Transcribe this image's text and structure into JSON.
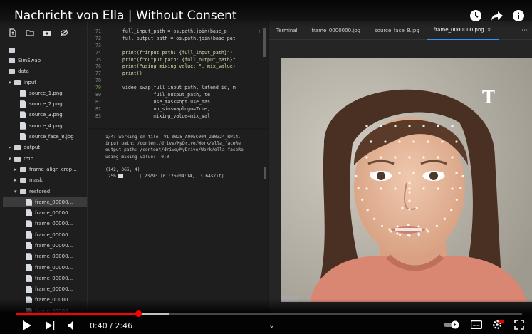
{
  "video": {
    "title": "Nachricht von Ella | Without Consent",
    "current_time": "0:40",
    "duration": "2:46",
    "time_separator": " / ",
    "progress_fraction": 0.241
  },
  "explorer": {
    "items": [
      {
        "label": "..",
        "type": "folder",
        "indent": 0,
        "caret": ""
      },
      {
        "label": "SimSwap",
        "type": "folder",
        "indent": 0,
        "caret": ""
      },
      {
        "label": "data",
        "type": "folder",
        "indent": 0,
        "caret": ""
      },
      {
        "label": "input",
        "type": "folder",
        "indent": 1,
        "caret": "▾"
      },
      {
        "label": "source_1.png",
        "type": "file",
        "indent": 2,
        "caret": ""
      },
      {
        "label": "source_2.png",
        "type": "file",
        "indent": 2,
        "caret": ""
      },
      {
        "label": "source_3.png",
        "type": "file",
        "indent": 2,
        "caret": ""
      },
      {
        "label": "source_4.png",
        "type": "file",
        "indent": 2,
        "caret": ""
      },
      {
        "label": "source_face_8.jpg",
        "type": "file",
        "indent": 2,
        "caret": ""
      },
      {
        "label": "output",
        "type": "folder",
        "indent": 1,
        "caret": "▸"
      },
      {
        "label": "tmp",
        "type": "folder",
        "indent": 1,
        "caret": "▾"
      },
      {
        "label": "frame_align_crop...",
        "type": "folder",
        "indent": 2,
        "caret": "▸"
      },
      {
        "label": "mask",
        "type": "folder",
        "indent": 2,
        "caret": "▸"
      },
      {
        "label": "restored",
        "type": "folder",
        "indent": 2,
        "caret": "▾"
      },
      {
        "label": "frame_00000...",
        "type": "file",
        "indent": 3,
        "caret": "",
        "selected": true
      },
      {
        "label": "frame_00000...",
        "type": "file",
        "indent": 3,
        "caret": ""
      },
      {
        "label": "frame_00000...",
        "type": "file",
        "indent": 3,
        "caret": ""
      },
      {
        "label": "frame_00000...",
        "type": "file",
        "indent": 3,
        "caret": ""
      },
      {
        "label": "frame_00000...",
        "type": "file",
        "indent": 3,
        "caret": ""
      },
      {
        "label": "frame_00000...",
        "type": "file",
        "indent": 3,
        "caret": ""
      },
      {
        "label": "frame_00000...",
        "type": "file",
        "indent": 3,
        "caret": ""
      },
      {
        "label": "frame_00000...",
        "type": "file",
        "indent": 3,
        "caret": ""
      },
      {
        "label": "frame_00000...",
        "type": "file",
        "indent": 3,
        "caret": ""
      },
      {
        "label": "frame_00000...",
        "type": "file",
        "indent": 3,
        "caret": ""
      },
      {
        "label": "frame_00000...",
        "type": "file",
        "indent": 3,
        "caret": ""
      }
    ],
    "selected_more": "⋮"
  },
  "editor": {
    "lines": [
      {
        "n": "71",
        "code": "    full_input_path = os.path.join(base_p"
      },
      {
        "n": "72",
        "code": "    full_output_path = os.path.join(base_pat"
      },
      {
        "n": "73",
        "code": ""
      },
      {
        "n": "74",
        "code": "    print(f\"input path: {full_input_path}\")"
      },
      {
        "n": "75",
        "code": "    print(f\"output path: {full_output_path}\""
      },
      {
        "n": "76",
        "code": "    print(\"using mixing value: \", mix_value)"
      },
      {
        "n": "77",
        "code": "    print()"
      },
      {
        "n": "78",
        "code": ""
      },
      {
        "n": "79",
        "code": "    video_swap(full_input_path, latend_id, m"
      },
      {
        "n": "80",
        "code": "               full_output_path, te"
      },
      {
        "n": "81",
        "code": "               use_mask=opt.use_mas"
      },
      {
        "n": "82",
        "code": "               no_simswaplogo=True,"
      },
      {
        "n": "83",
        "code": "               mixing_value=mix_val"
      }
    ]
  },
  "output": {
    "lines": [
      "1/4: working on file: V1-0025_A005C004_230324_RP14.",
      "input path: /content/drive/MyDrive/Work/ella_faceRe",
      "output path: /content/drive/MyDrive/Work/ella_faceRe",
      "using mixing value:  0.0",
      "",
      "(142, 366, 4)"
    ],
    "progress_pct": " 25%",
    "progress_text": "| 23/93 [01:26<04:14,  3.64s/it]"
  },
  "preview": {
    "tabs": [
      {
        "label": "Terminal",
        "active": false
      },
      {
        "label": "frame_0000000.jpg",
        "active": false
      },
      {
        "label": "source_face_8.jpg",
        "active": false
      },
      {
        "label": "frame_0000000.png",
        "active": true,
        "close": "×"
      }
    ],
    "tab_more": "⋯",
    "logo_text": "T"
  },
  "icons": {
    "title": [
      "clock-icon",
      "share-icon",
      "info-icon"
    ],
    "controls_left": [
      "play-icon",
      "next-icon",
      "volume-icon"
    ],
    "controls_right": [
      "autoplay-toggle-icon",
      "subtitles-icon",
      "settings-icon",
      "fullscreen-icon"
    ]
  },
  "colors": {
    "accent_red": "#ff0000",
    "active_tab": "#3794ff"
  }
}
